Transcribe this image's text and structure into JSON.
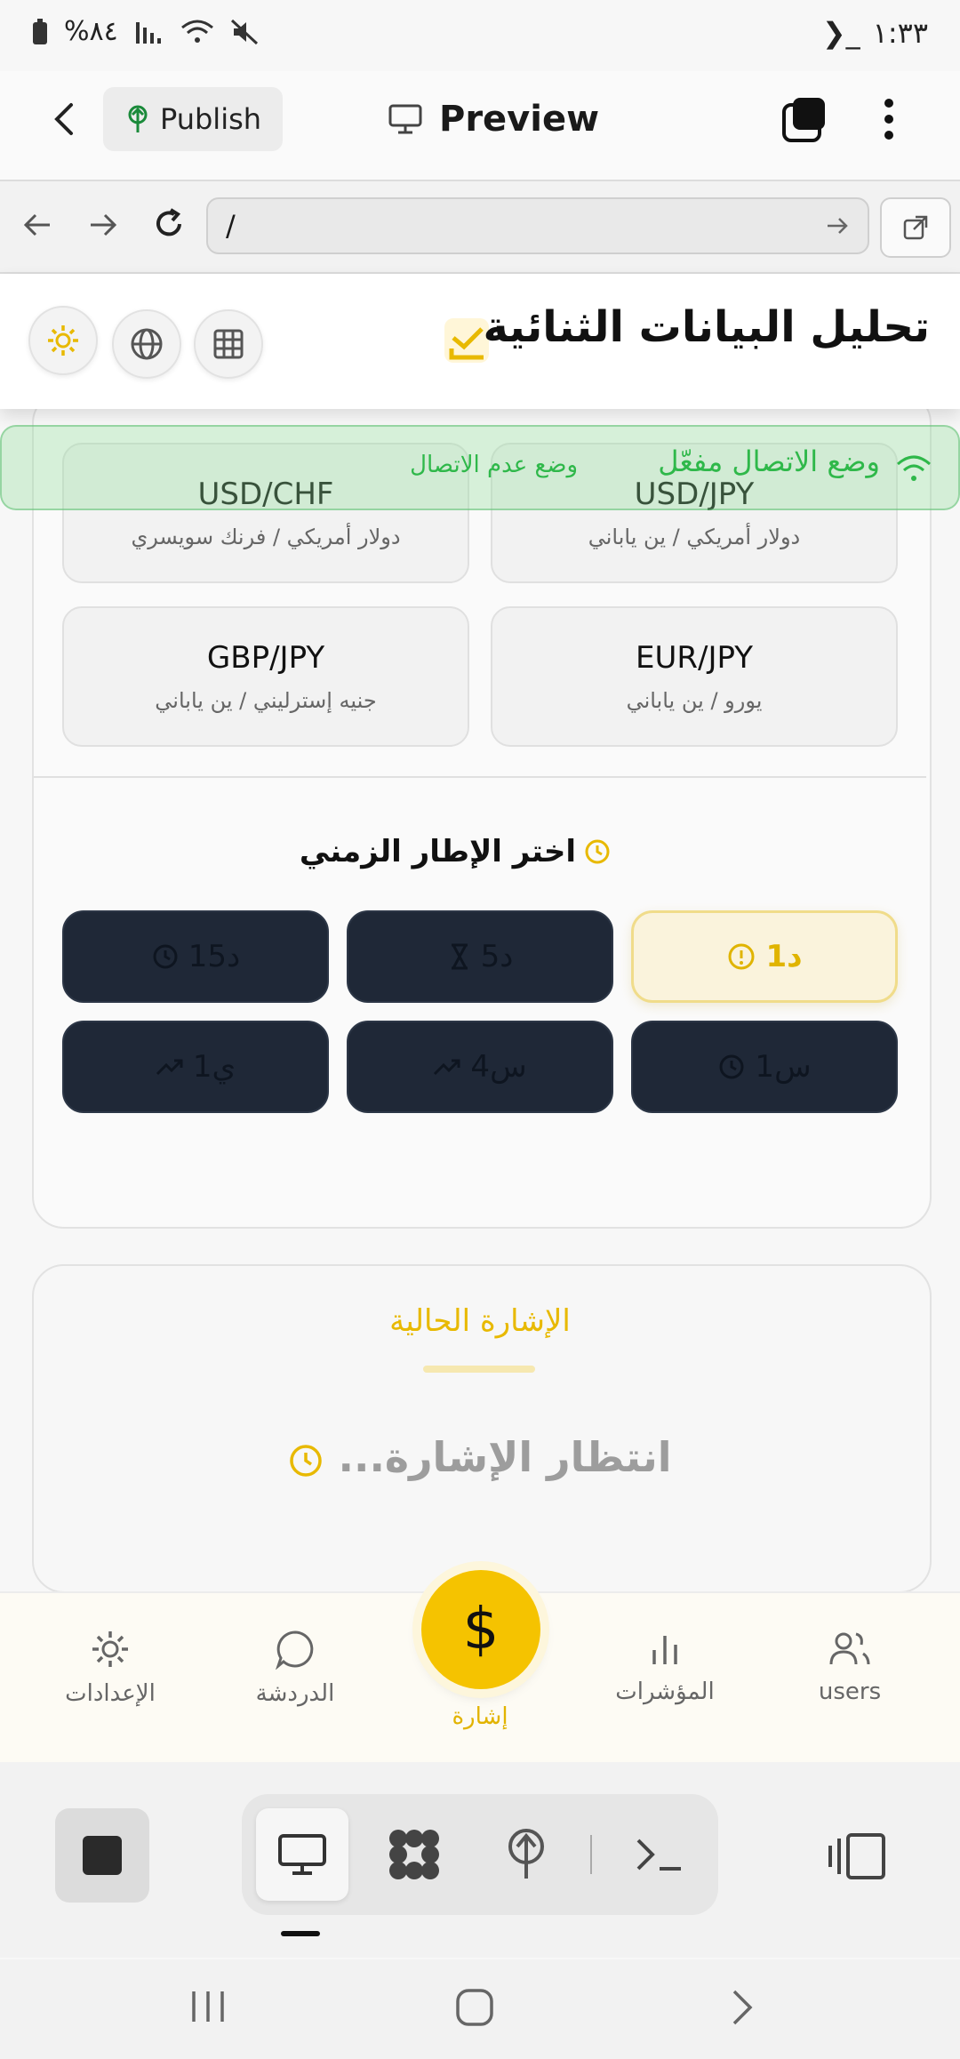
{
  "status_bar": {
    "time": "١:٣٣",
    "terminal_glyph": "❯_",
    "battery": "%٨٤"
  },
  "app_bar": {
    "publish_label": "Publish",
    "preview_label": "Preview"
  },
  "url_bar": {
    "value": "/"
  },
  "page": {
    "title": "تحليل البيانات الثنائية",
    "pairs": [
      {
        "symbol": "USD/JPY",
        "name": "دولار أمريكي / ين ياباني"
      },
      {
        "symbol": "USD/CHF",
        "name": "دولار أمريكي / فرنك سويسري"
      },
      {
        "symbol": "EUR/JPY",
        "name": "يورو / ين ياباني"
      },
      {
        "symbol": "GBP/JPY",
        "name": "جنيه إسترليني / ين ياباني"
      }
    ],
    "timeframe_heading": "اختر الإطار الزمني",
    "timeframes": [
      {
        "label": "1د",
        "icon": "alert-clock-icon",
        "active": true
      },
      {
        "label": "5د",
        "icon": "hourglass-icon",
        "active": false
      },
      {
        "label": "15د",
        "icon": "clock-icon",
        "active": false
      },
      {
        "label": "1س",
        "icon": "clock-icon",
        "active": false
      },
      {
        "label": "4س",
        "icon": "trend-icon",
        "active": false
      },
      {
        "label": "1ي",
        "icon": "trend-icon",
        "active": false
      }
    ],
    "signal_title": "الإشارة الحالية",
    "signal_waiting": "انتظار الإشارة..."
  },
  "toast": {
    "main": "وضع الاتصال مفعّل",
    "sub": "وضع عدم الاتصال"
  },
  "bottom_nav": {
    "users": "users",
    "indicators": "المؤشرات",
    "signal": "إشارة",
    "chat": "الدردشة",
    "settings": "الإعدادات",
    "fab_symbol": "$"
  },
  "colors": {
    "accent": "#f5c300",
    "dark_button": "#1f2837",
    "toast_green": "#2fb84a"
  }
}
